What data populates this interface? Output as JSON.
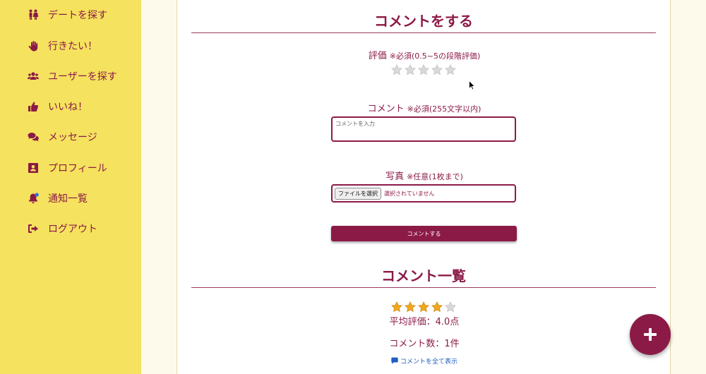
{
  "sidebar": {
    "items": [
      {
        "label": "デートを探す",
        "icon": "couple-icon"
      },
      {
        "label": "行きたい！",
        "icon": "hand-icon"
      },
      {
        "label": "ユーザーを探す",
        "icon": "users-icon"
      },
      {
        "label": "いいね！",
        "icon": "thumbs-up-icon"
      },
      {
        "label": "メッセージ",
        "icon": "comments-icon"
      },
      {
        "label": "プロフィール",
        "icon": "id-card-icon"
      },
      {
        "label": "通知一覧",
        "icon": "bell-icon"
      },
      {
        "label": "ログアウト",
        "icon": "logout-icon"
      }
    ]
  },
  "comment_form": {
    "title": "コメントをする",
    "rating_label": "評価",
    "rating_note": "※必須(0.5~5の段階評価)",
    "rating_value": 0,
    "rating_max": 5,
    "comment_label": "コメント",
    "comment_note": "※必須(255文字以内)",
    "comment_placeholder": "コメントを入力",
    "photo_label": "写真",
    "photo_note": "※任意(1枚まで)",
    "file_button": "ファイルを選択",
    "file_status": "選択されていません",
    "submit_label": "コメントする"
  },
  "comment_list": {
    "title": "コメント一覧",
    "average_rating": 4.0,
    "average_text": "平均評価：4.0点",
    "count_text": "コメント数：1件",
    "show_all_label": "コメントを全て表示"
  },
  "colors": {
    "accent": "#8b1a47",
    "sidebar_bg": "#f5e25e",
    "page_bg": "#fdfaeb",
    "star_filled": "#f0a81c",
    "star_empty": "#d9d9d9",
    "link": "#1e5fbf",
    "notification_dot": "#2f6fe0"
  }
}
